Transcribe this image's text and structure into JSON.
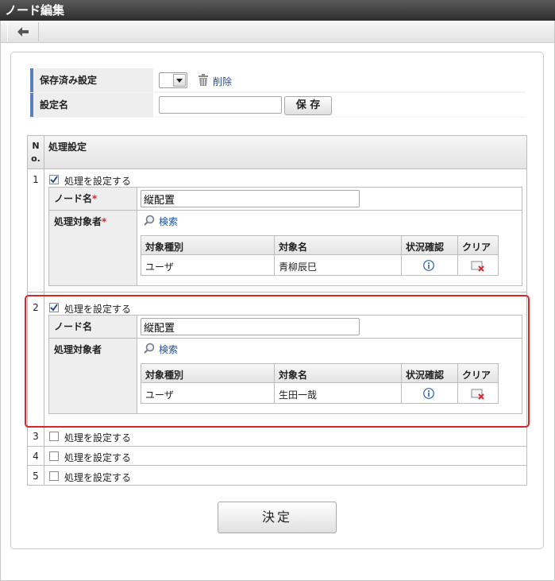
{
  "window": {
    "title": "ノード編集"
  },
  "toolbar": {
    "back_icon": "arrow-left-icon"
  },
  "saved_settings": {
    "label": "保存済み設定",
    "delete_label": "削除"
  },
  "setting_name": {
    "label": "設定名",
    "value": "",
    "save_label": "保 存"
  },
  "process_table": {
    "col_no": "No.",
    "col_setting": "処理設定",
    "enable_label": "処理を設定する",
    "node_name_label": "ノード名",
    "target_label": "処理対象者",
    "required_mark": "*",
    "search_label": "検索",
    "sub_headers": [
      "対象種別",
      "対象名",
      "状況確認",
      "クリア"
    ],
    "rows": [
      {
        "no": "1",
        "checked": true,
        "node_name": "縦配置",
        "required": true,
        "target_type": "ユーザ",
        "target_name": "青柳辰巳"
      },
      {
        "no": "2",
        "checked": true,
        "node_name": "縦配置",
        "required": false,
        "target_type": "ユーザ",
        "target_name": "生田一哉"
      },
      {
        "no": "3",
        "checked": false
      },
      {
        "no": "4",
        "checked": false
      },
      {
        "no": "5",
        "checked": false
      }
    ]
  },
  "decide_label": "決定",
  "colors": {
    "highlight": "#d8262b",
    "accent": "#5b7fb8"
  }
}
